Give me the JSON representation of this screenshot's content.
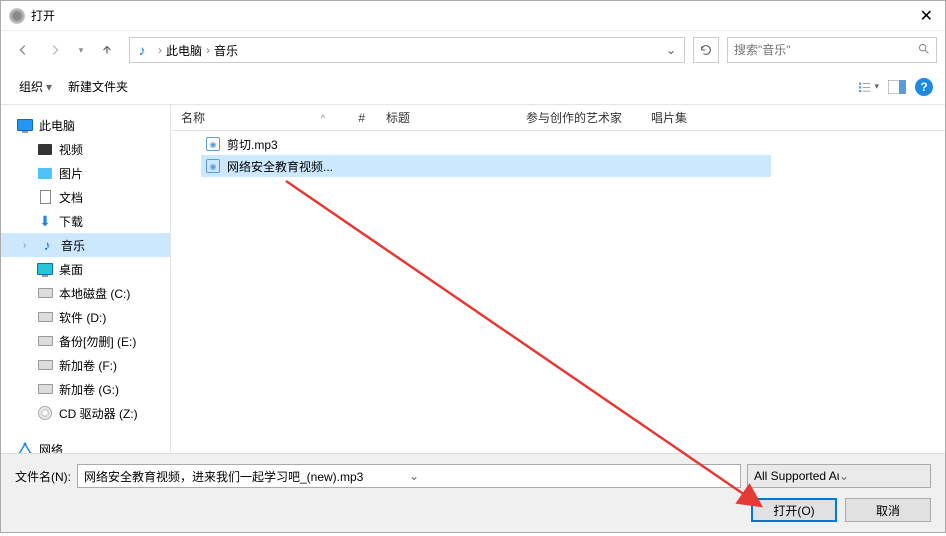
{
  "window": {
    "title": "打开"
  },
  "breadcrumb": {
    "item1": "此电脑",
    "item2": "音乐"
  },
  "search": {
    "placeholder": "搜索\"音乐\""
  },
  "toolbar": {
    "organize": "组织",
    "newfolder": "新建文件夹"
  },
  "sidebar": {
    "thispc": "此电脑",
    "video": "视频",
    "pictures": "图片",
    "documents": "文档",
    "downloads": "下载",
    "music": "音乐",
    "desktop": "桌面",
    "localc": "本地磁盘 (C:)",
    "softd": "软件 (D:)",
    "backupe": "备份[勿删] (E:)",
    "volf": "新加卷 (F:)",
    "volg": "新加卷 (G:)",
    "cdz": "CD 驱动器 (Z:)",
    "network": "网络"
  },
  "columns": {
    "name": "名称",
    "num": "#",
    "title": "标题",
    "artist": "参与创作的艺术家",
    "album": "唱片集"
  },
  "files": {
    "f1": "剪切.mp3",
    "f2": "网络安全教育视频..."
  },
  "footer": {
    "label": "文件名(N):",
    "value": "网络安全教育视频，进来我们一起学习吧_(new).mp3",
    "filter": "All Supported Audio&Video",
    "open": "打开(O)",
    "cancel": "取消"
  }
}
